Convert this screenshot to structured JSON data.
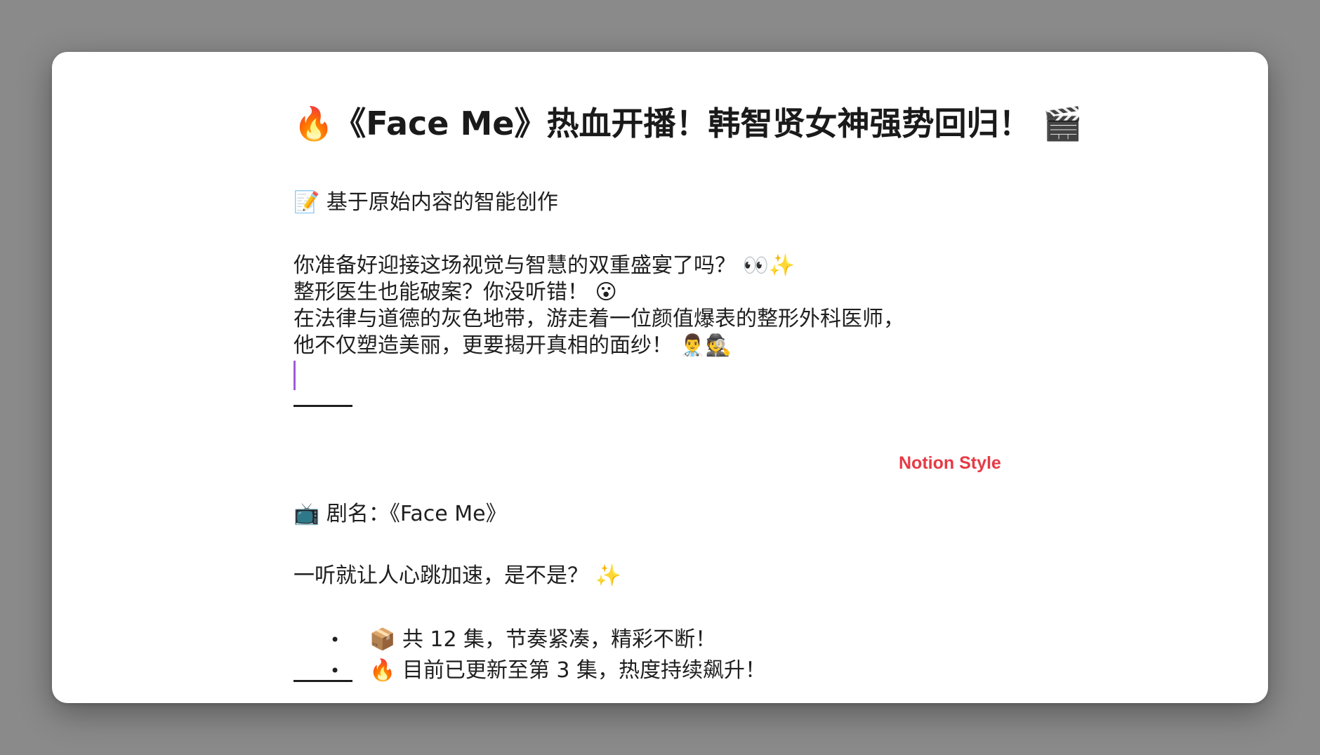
{
  "title": "🔥《Face Me》热血开播！韩智贤女神强势回归！ 🎬",
  "subtitle": "📝 基于原始内容的智能创作",
  "intro": [
    "你准备好迎接这场视觉与智慧的双重盛宴了吗？ 👀✨",
    "整形医生也能破案？你没听错！ 😮",
    "在法律与道德的灰色地带，游走着一位颜值爆表的整形外科医师，",
    "他不仅塑造美丽，更要揭开真相的面纱！ 👨‍⚕️🕵️"
  ],
  "show_name": "📺 剧名：《Face Me》",
  "style_label": "Notion Style",
  "hook": "一听就让人心跳加速，是不是？ ✨",
  "bullets": [
    "📦 共 12 集，节奏紧凑，精彩不断！",
    "🔥 目前已更新至第 3 集，热度持续飙升！"
  ],
  "colors": {
    "background": "#8a8a8a",
    "window": "#ffffff",
    "text": "#1f1f1f",
    "accent": "#e73a45",
    "cursor": "#a25ad9"
  }
}
